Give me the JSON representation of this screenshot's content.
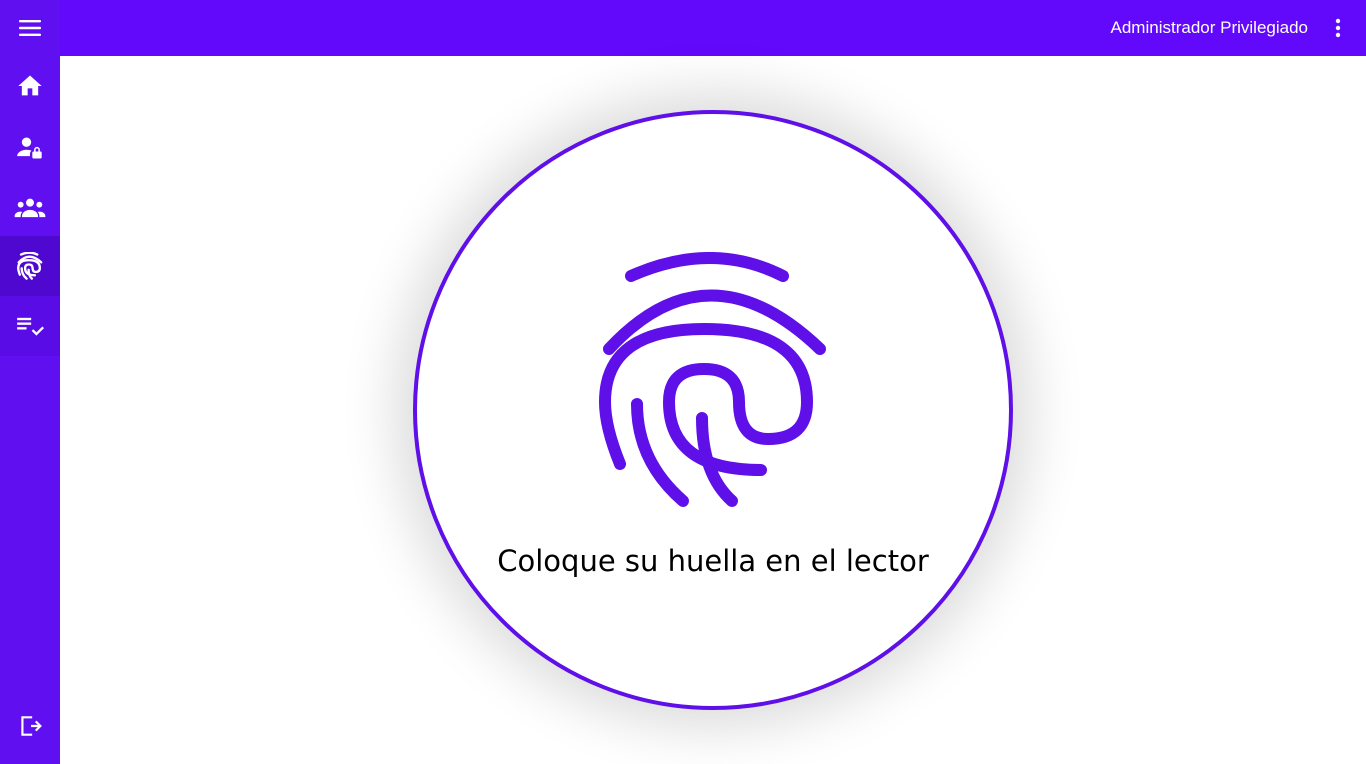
{
  "header": {
    "user_name": "Administrador Privilegiado",
    "background_color": "#6309fb"
  },
  "sidebar": {
    "background_color": "#5f0ff0",
    "items": [
      {
        "icon": "menu-icon"
      },
      {
        "icon": "home-icon"
      },
      {
        "icon": "user-lock-icon"
      },
      {
        "icon": "group-icon"
      },
      {
        "icon": "fingerprint-icon",
        "active": true
      },
      {
        "icon": "checklist-icon"
      },
      {
        "icon": "logout-icon"
      }
    ]
  },
  "main": {
    "prompt": "Coloque su huella en el lector",
    "accent_color": "#5f0fe8",
    "icon": "fingerprint-icon"
  }
}
